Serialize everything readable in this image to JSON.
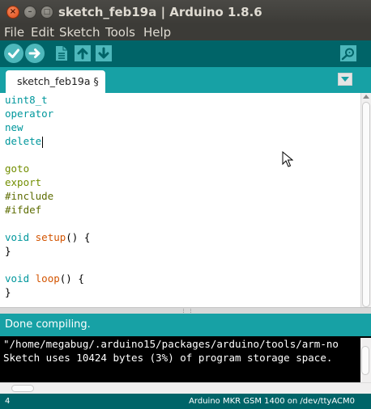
{
  "window": {
    "title": "sketch_feb19a | Arduino 1.8.6",
    "controls": {
      "close_glyph": "×",
      "minimize_glyph": "–",
      "maximize_glyph": "□"
    }
  },
  "menu": {
    "items": [
      {
        "label": "File"
      },
      {
        "label": "Edit"
      },
      {
        "label": "Sketch"
      },
      {
        "label": "Tools"
      },
      {
        "label": "Help"
      }
    ]
  },
  "toolbar": {
    "buttons": [
      {
        "name": "verify",
        "icon": "checkmark-icon"
      },
      {
        "name": "upload",
        "icon": "arrow-right-icon"
      },
      {
        "name": "new",
        "icon": "new-file-icon"
      },
      {
        "name": "open",
        "icon": "arrow-up-icon"
      },
      {
        "name": "save",
        "icon": "arrow-down-icon"
      },
      {
        "name": "serial-monitor",
        "icon": "magnifier-icon"
      }
    ],
    "colors": {
      "bar": "#006468",
      "button": "#4db7bb"
    }
  },
  "tabs": [
    {
      "label": "sketch_feb19a §"
    }
  ],
  "editor": {
    "lines": [
      [
        {
          "t": "uint8_t",
          "c": "kw-type"
        }
      ],
      [
        {
          "t": "operator",
          "c": "kw-type"
        }
      ],
      [
        {
          "t": "new",
          "c": "kw-type"
        }
      ],
      [
        {
          "t": "delete",
          "c": "kw-type"
        }
      ],
      [],
      [
        {
          "t": "goto",
          "c": "kw-ctl"
        }
      ],
      [
        {
          "t": "export",
          "c": "kw-ctl"
        }
      ],
      [
        {
          "t": "#include",
          "c": "kw-pre"
        }
      ],
      [
        {
          "t": "#ifdef",
          "c": "kw-pre"
        }
      ],
      [],
      [
        {
          "t": "void",
          "c": "kw-type"
        },
        {
          "t": " ",
          "c": "kw-sym"
        },
        {
          "t": "setup",
          "c": "kw-fn"
        },
        {
          "t": "() {",
          "c": "kw-sym"
        }
      ],
      [
        {
          "t": "}",
          "c": "kw-sym"
        }
      ],
      [],
      [
        {
          "t": "void",
          "c": "kw-type"
        },
        {
          "t": " ",
          "c": "kw-sym"
        },
        {
          "t": "loop",
          "c": "kw-fn"
        },
        {
          "t": "() {",
          "c": "kw-sym"
        }
      ],
      [
        {
          "t": "}",
          "c": "kw-sym"
        }
      ]
    ],
    "caret_line": 3
  },
  "status": {
    "message": "Done compiling."
  },
  "console": {
    "lines": [
      "\"/home/megabug/.arduino15/packages/arduino/tools/arm-no",
      "Sketch uses 10424 bytes (3%) of program storage space."
    ]
  },
  "footer": {
    "line_number": "4",
    "board": "Arduino MKR GSM 1400 on /dev/ttyACM0"
  }
}
